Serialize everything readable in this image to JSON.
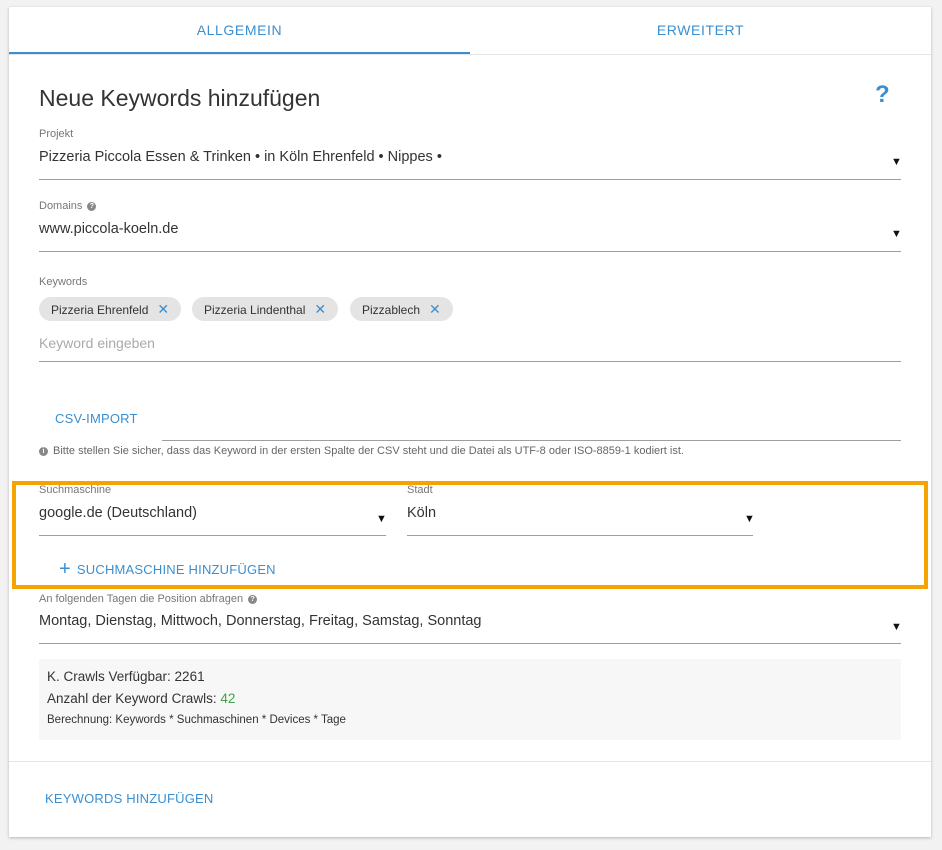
{
  "tabs": [
    {
      "label": "ALLGEMEIN",
      "active": true
    },
    {
      "label": "ERWEITERT",
      "active": false
    }
  ],
  "form": {
    "title": "Neue Keywords hinzufügen",
    "help_glyph": "?",
    "project": {
      "label": "Projekt",
      "value": "Pizzeria Piccola Essen & Trinken • in Köln Ehrenfeld • Nippes •"
    },
    "domains": {
      "label": "Domains",
      "value": "www.piccola-koeln.de"
    },
    "keywords": {
      "label": "Keywords",
      "chips": [
        "Pizzeria Ehrenfeld",
        "Pizzeria Lindenthal",
        "Pizzablech"
      ],
      "placeholder": "Keyword eingeben"
    },
    "csv_import_label": "CSV-IMPORT",
    "csv_info": "Bitte stellen Sie sicher, dass das Keyword in der ersten Spalte der CSV steht und die Datei als UTF-8 oder ISO-8859-1 kodiert ist.",
    "search_engine": {
      "label": "Suchmaschine",
      "value": "google.de (Deutschland)"
    },
    "city": {
      "label": "Stadt",
      "value": "Köln"
    },
    "add_search_engine_label": "SUCHMASCHINE HINZUFÜGEN",
    "days": {
      "label": "An folgenden Tagen die Position abfragen",
      "value": "Montag, Dienstag, Mittwoch, Donnerstag, Freitag, Samstag, Sonntag"
    },
    "crawls": {
      "available_text": "K. Crawls Verfügbar: 2261",
      "count_label": "Anzahl der Keyword Crawls: ",
      "count_value": "42",
      "calculation": "Berechnung: Keywords * Suchmaschinen * Devices * Tage"
    },
    "submit_label": "KEYWORDS HINZUFÜGEN"
  },
  "colors": {
    "accent": "#3b8fd0",
    "highlight": "#f5a300",
    "count": "#43a047"
  }
}
